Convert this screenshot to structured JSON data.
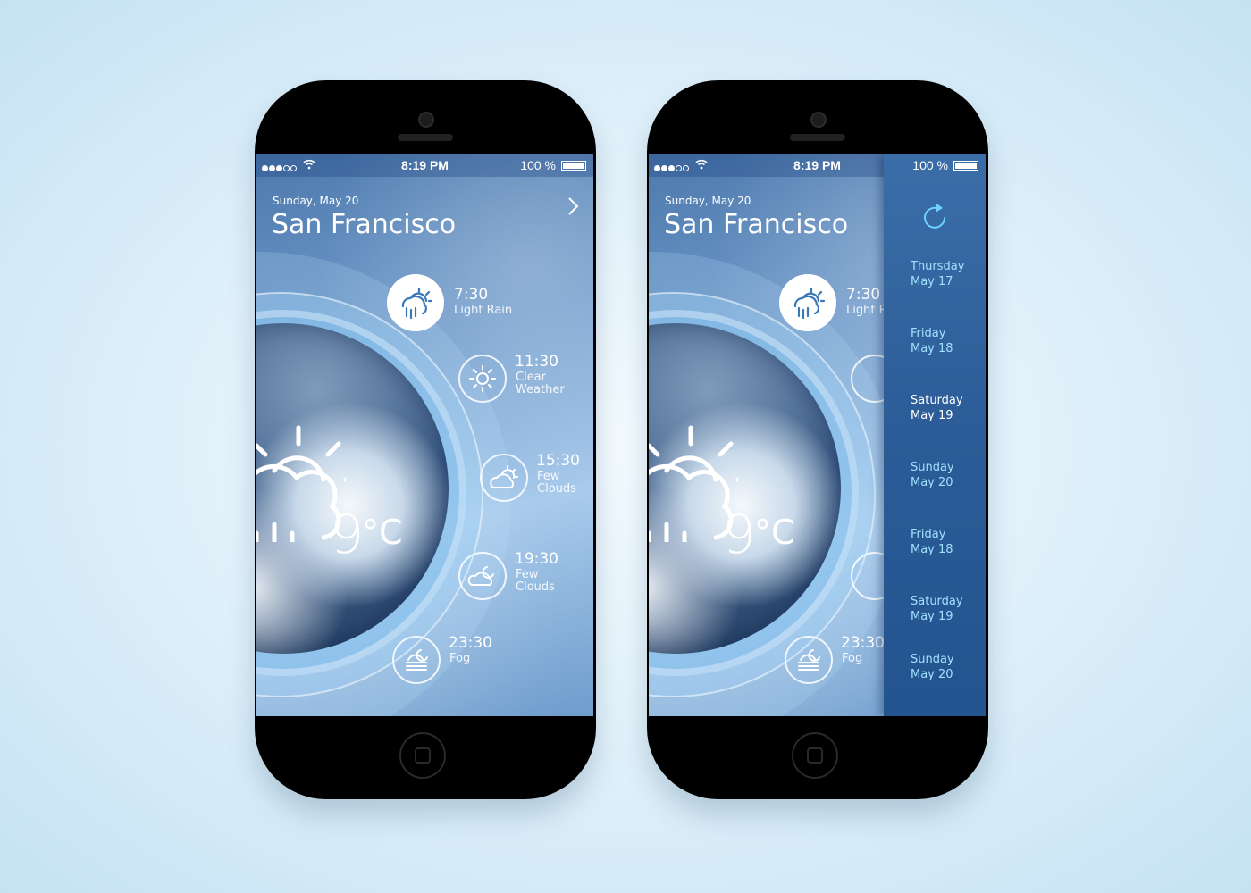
{
  "status": {
    "time": "8:19 PM",
    "battery": "100 %"
  },
  "header": {
    "date": "Sunday, May 20",
    "city": "San Francisco"
  },
  "current": {
    "temperature": "9",
    "unit": "°C",
    "icon": "rain-sun-icon"
  },
  "hourly": [
    {
      "time": "7:30",
      "desc": "Light Rain",
      "icon": "light-rain-icon"
    },
    {
      "time": "11:30",
      "desc": "Clear Weather",
      "desc_lines": [
        "Clear",
        "Weather"
      ],
      "icon": "sun-icon"
    },
    {
      "time": "15:30",
      "desc": "Few Clouds",
      "desc_lines": [
        "Few",
        "Clouds"
      ],
      "icon": "partly-cloudy-icon"
    },
    {
      "time": "19:30",
      "desc": "Few Clouds",
      "desc_lines": [
        "Few",
        "Clouds"
      ],
      "icon": "night-cloud-icon"
    },
    {
      "time": "23:30",
      "desc": "Fog",
      "icon": "fog-icon"
    }
  ],
  "hourly_truncated": {
    "first_desc": "Light R"
  },
  "sidebar": {
    "days": [
      {
        "day": "Thursday",
        "date": "May 17"
      },
      {
        "day": "Friday",
        "date": "May 18"
      },
      {
        "day": "Saturday",
        "date": "May 19"
      },
      {
        "day": "Sunday",
        "date": "May 20"
      },
      {
        "day": "Friday",
        "date": "May 18"
      },
      {
        "day": "Saturday",
        "date": "May 19"
      },
      {
        "day": "Sunday",
        "date": "May 20"
      }
    ],
    "active_index": 2
  },
  "colors": {
    "accent": "#9fe0ff",
    "sidebar": "#2c5c97",
    "icon_blue": "#3a78b8"
  }
}
